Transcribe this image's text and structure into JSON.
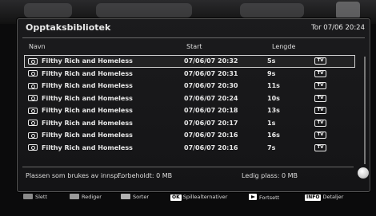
{
  "header": {
    "title": "Opptaksbibliotek",
    "datetime": "Tor 07/06 20:24"
  },
  "columns": {
    "name": "Navn",
    "start": "Start",
    "length": "Lengde"
  },
  "recordings": [
    {
      "name": "Filthy Rich and Homeless",
      "start": "07/06/07 20:32",
      "length": "5s",
      "channel": "TV",
      "selected": true
    },
    {
      "name": "Filthy Rich and Homeless",
      "start": "07/06/07 20:31",
      "length": "9s",
      "channel": "TV"
    },
    {
      "name": "Filthy Rich and Homeless",
      "start": "07/06/07 20:30",
      "length": "11s",
      "channel": "TV"
    },
    {
      "name": "Filthy Rich and Homeless",
      "start": "07/06/07 20:24",
      "length": "10s",
      "channel": "TV"
    },
    {
      "name": "Filthy Rich and Homeless",
      "start": "07/06/07 20:18",
      "length": "13s",
      "channel": "TV"
    },
    {
      "name": "Filthy Rich and Homeless",
      "start": "07/06/07 20:17",
      "length": "1s",
      "channel": "TV"
    },
    {
      "name": "Filthy Rich and Homeless",
      "start": "07/06/07 20:16",
      "length": "16s",
      "channel": "TV"
    },
    {
      "name": "Filthy Rich and Homeless",
      "start": "07/06/07 20:16",
      "length": "7s",
      "channel": "TV"
    }
  ],
  "status": {
    "space_used": "Plassen som brukes av innsp...",
    "reserved": "Forbeholdt: 0 MB",
    "free_space": "Ledig plass: 0 MB"
  },
  "footer": {
    "delete": {
      "label": "Slett",
      "color": "#8a8a8a"
    },
    "edit": {
      "label": "Rediger",
      "color": "#9a9a9a"
    },
    "sort": {
      "label": "Sorter",
      "color": "#b0b0b0"
    },
    "playback_options": {
      "key": "OK",
      "label": "Spillealternativer"
    },
    "resume": {
      "label": "Fortsett"
    },
    "details": {
      "key": "INFO",
      "label": "Detaljer"
    }
  }
}
